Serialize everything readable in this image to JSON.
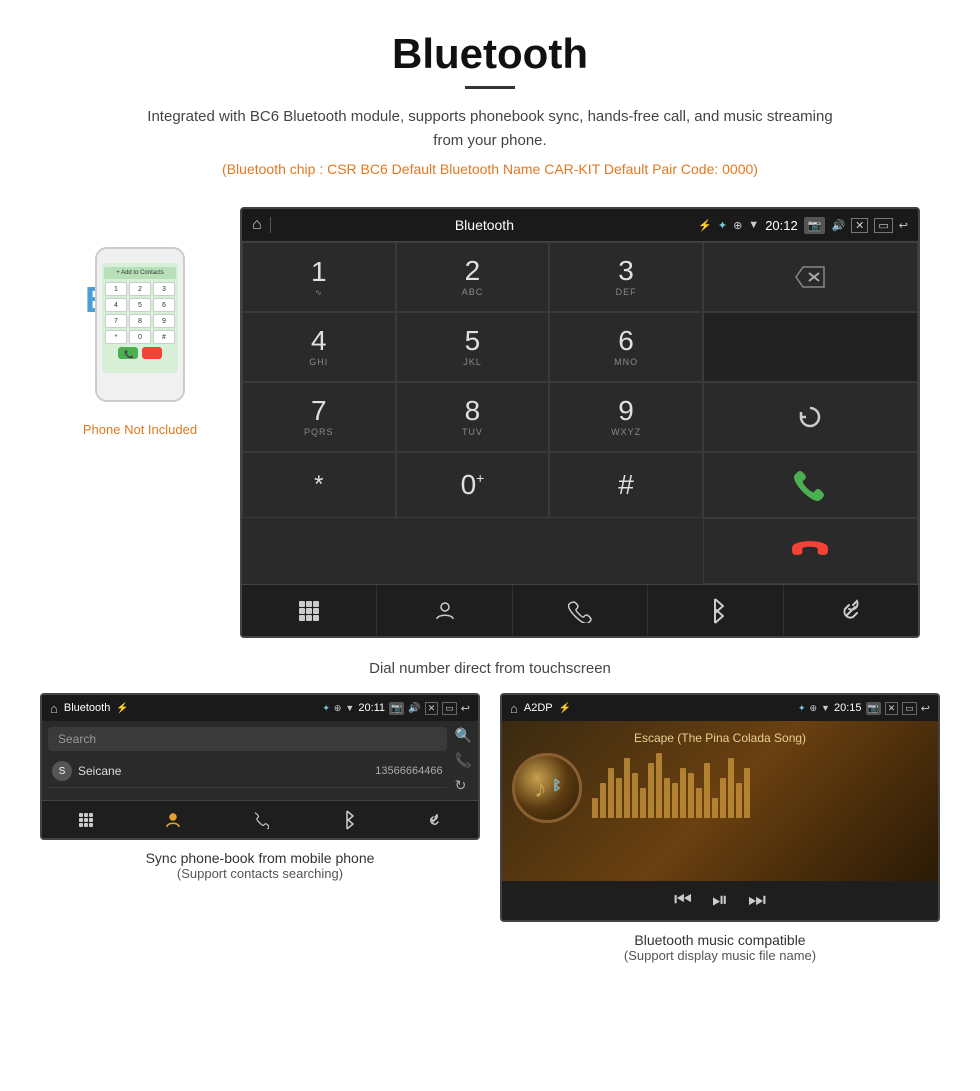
{
  "header": {
    "title": "Bluetooth",
    "description": "Integrated with BC6 Bluetooth module, supports phonebook sync, hands-free call, and music streaming from your phone.",
    "info_line": "(Bluetooth chip : CSR BC6    Default Bluetooth Name CAR-KIT    Default Pair Code: 0000)"
  },
  "phone_illustration": {
    "not_included": "Phone Not Included"
  },
  "car_screen_dial": {
    "statusbar": {
      "app_name": "Bluetooth",
      "time": "20:12"
    },
    "keys": [
      {
        "number": "1",
        "letters": ""
      },
      {
        "number": "2",
        "letters": "ABC"
      },
      {
        "number": "3",
        "letters": "DEF"
      },
      {
        "number": "4",
        "letters": "GHI"
      },
      {
        "number": "5",
        "letters": "JKL"
      },
      {
        "number": "6",
        "letters": "MNO"
      },
      {
        "number": "7",
        "letters": "PQRS"
      },
      {
        "number": "8",
        "letters": "TUV"
      },
      {
        "number": "9",
        "letters": "WXYZ"
      },
      {
        "number": "*",
        "letters": ""
      },
      {
        "number": "0",
        "letters": "+"
      },
      {
        "number": "#",
        "letters": ""
      }
    ],
    "subtitle": "Dial number direct from touchscreen"
  },
  "phonebook_screen": {
    "statusbar": {
      "app_name": "Bluetooth",
      "time": "20:11"
    },
    "search_placeholder": "Search",
    "contacts": [
      {
        "letter": "S",
        "name": "Seicane",
        "number": "13566664466"
      }
    ],
    "caption_main": "Sync phone-book from mobile phone",
    "caption_sub": "(Support contacts searching)"
  },
  "music_screen": {
    "statusbar": {
      "app_name": "A2DP",
      "time": "20:15"
    },
    "song_title": "Escape (The Pina Colada Song)",
    "eq_bars": [
      20,
      35,
      50,
      40,
      60,
      45,
      30,
      55,
      65,
      40,
      35,
      50,
      45,
      30,
      55,
      20,
      40,
      60,
      35,
      50
    ],
    "caption_main": "Bluetooth music compatible",
    "caption_sub": "(Support display music file name)"
  }
}
